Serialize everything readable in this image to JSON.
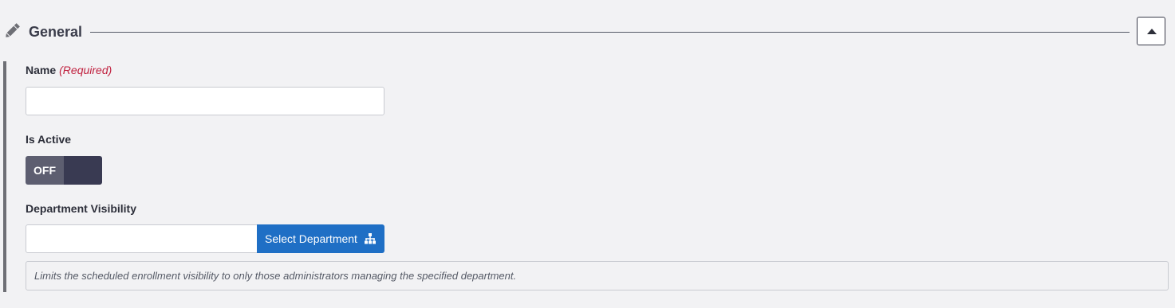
{
  "section": {
    "title": "General",
    "collapse_button": "collapse"
  },
  "fields": {
    "name": {
      "label": "Name",
      "required_text": "(Required)",
      "value": "",
      "placeholder": ""
    },
    "is_active": {
      "label": "Is Active",
      "state_text": "OFF"
    },
    "department_visibility": {
      "label": "Department Visibility",
      "value": "",
      "button_label": "Select Department",
      "help_text": "Limits the scheduled enrollment visibility to only those administrators managing the specified department."
    }
  },
  "icons": {
    "section_icon": "pencil-icon",
    "collapse_icon": "caret-up-icon",
    "department_icon": "sitemap-icon"
  },
  "colors": {
    "required": "#c0203e",
    "primary_button": "#1f6fc5",
    "toggle_off": "#5d5e70",
    "toggle_knob": "#393a52"
  }
}
